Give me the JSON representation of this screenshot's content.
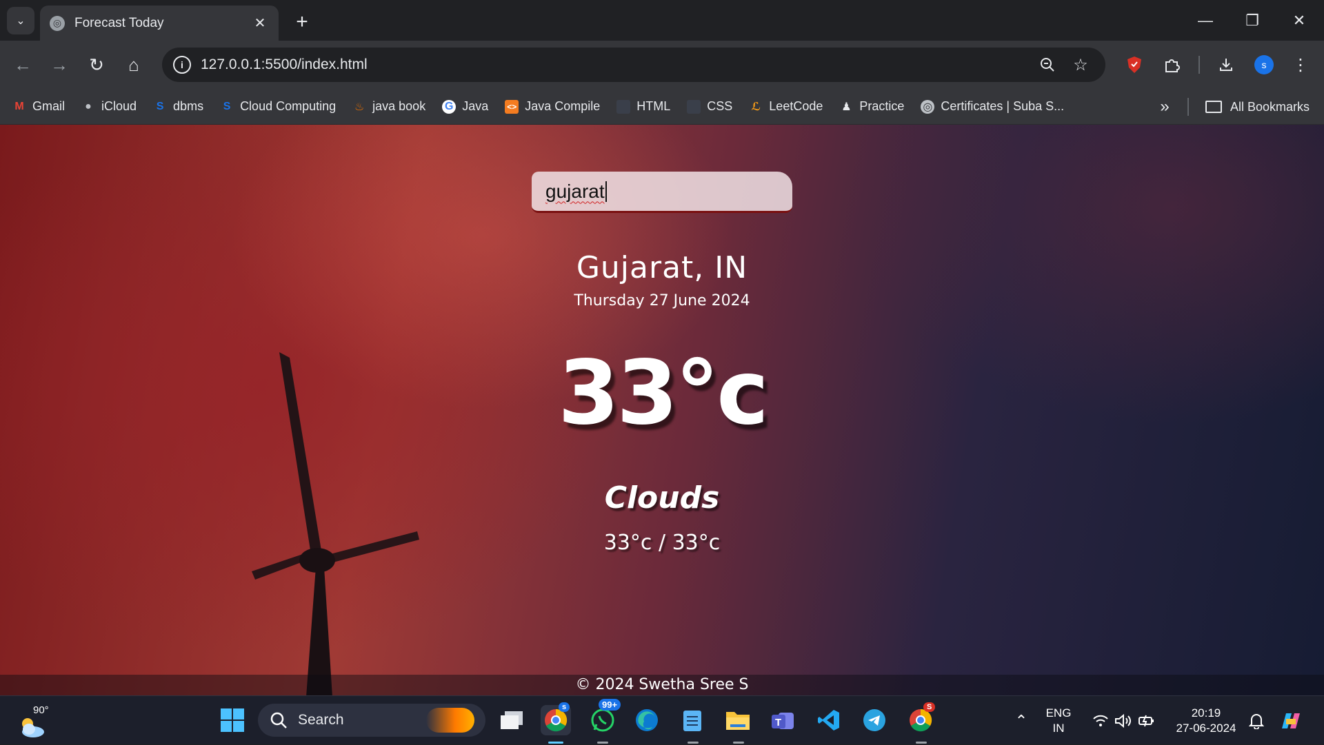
{
  "browser": {
    "tab_title": "Forecast Today",
    "url": "127.0.0.1:5500/index.html",
    "profile_initial": "s"
  },
  "bookmarks": {
    "items": [
      {
        "label": "Gmail",
        "icon": "gmail-icon"
      },
      {
        "label": "iCloud",
        "icon": "apple-icon"
      },
      {
        "label": "dbms",
        "icon": "s-logo-icon"
      },
      {
        "label": "Cloud Computing",
        "icon": "s-logo-icon"
      },
      {
        "label": "java book",
        "icon": "java-icon"
      },
      {
        "label": "Java",
        "icon": "google-icon"
      },
      {
        "label": "Java Compile",
        "icon": "compiler-icon"
      },
      {
        "label": "HTML",
        "icon": "html-icon"
      },
      {
        "label": "CSS",
        "icon": "css-icon"
      },
      {
        "label": "LeetCode",
        "icon": "leetcode-icon"
      },
      {
        "label": "Practice",
        "icon": "practice-icon"
      },
      {
        "label": "Certificates | Suba S...",
        "icon": "globe-icon"
      }
    ],
    "all_label": "All Bookmarks"
  },
  "app": {
    "search_value": "gujarat",
    "city": "Gujarat, IN",
    "date": "Thursday 27 June 2024",
    "temperature": "33°c",
    "weather": "Clouds",
    "hi_low": "33°c / 33°c",
    "footer": "© 2024 Swetha Sree S"
  },
  "taskbar": {
    "weather_temp": "90°",
    "search_label": "Search",
    "whatsapp_badge": "99+",
    "chrome_badge": "s",
    "chrome2_badge": "S",
    "lang_top": "ENG",
    "lang_bottom": "IN",
    "time": "20:19",
    "date": "27-06-2024"
  },
  "colors": {
    "chrome_dark": "#202124",
    "chrome_toolbar": "#35363a",
    "accent_blue": "#1a73e8",
    "taskbar": "#1c1f2b"
  }
}
